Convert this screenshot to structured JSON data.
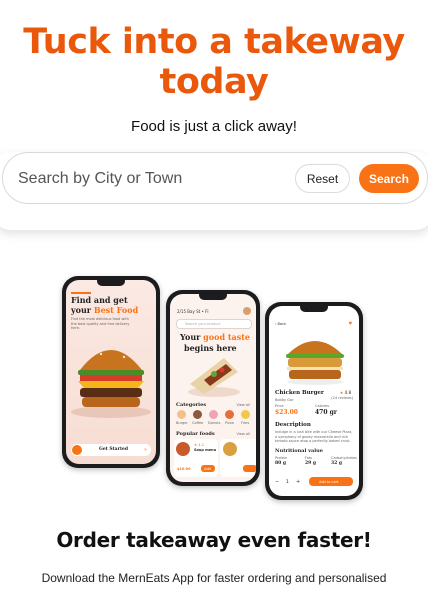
{
  "hero": {
    "title_line1": "Tuck into a takeway",
    "title_line2": "today",
    "subtitle": "Food is just a click away!"
  },
  "search": {
    "placeholder": "Search by City or Town",
    "value": "",
    "reset_label": "Reset",
    "search_label": "Search"
  },
  "promo": {
    "title": "Order takeaway even faster!",
    "subtitle": "Download the MernEats App for faster ordering and personalised"
  },
  "phone_mockups": {
    "left": {
      "heading_line1": "Find and get",
      "heading_line2_plain": "your ",
      "heading_line2_accent": "Best Food",
      "body": "Find the most delicious food with the best quality and free delivery here.",
      "cta": "Get Started"
    },
    "middle": {
      "location": "2/15 Bay St • Fl",
      "search_placeholder": "Search your product",
      "headline_plain": "Your ",
      "headline_accent": "good taste",
      "headline_line2": "begins here",
      "categories_title": "Categories",
      "categories_link": "View all",
      "categories": [
        "Burger",
        "Coffee",
        "Donuts",
        "Pizza",
        "Fries"
      ],
      "popular_title": "Popular foods",
      "popular_link": "View all",
      "popular_item_name": "Soup menu",
      "popular_item_rating": "★ 4.2",
      "popular_item_price": "$10.00",
      "add_label": "Add"
    },
    "right": {
      "back_label": "Back",
      "product_name": "Chicken Burger",
      "rating": "4.8",
      "rating_sub": "(24 reviews)",
      "store": "Bobby Gar",
      "price_label": "Price",
      "price": "$23.00",
      "calories_label": "Calories",
      "calories": "470 gr",
      "description_title": "Description",
      "description": "Indulge in a lush bite with our Cheese Pizza, a symphony of gooey mozzarella and rich tomato sauce atop a perfectly baked crust. Read more...",
      "nutrition_title": "Nutritional value",
      "nutrition": [
        {
          "label": "Protein",
          "value": "80 g"
        },
        {
          "label": "Fats",
          "value": "29 g"
        },
        {
          "label": "Carbohydrates",
          "value": "32 g"
        }
      ],
      "quantity": "1",
      "cart_label": "Add to cart"
    }
  },
  "colors": {
    "accent": "#ea580c",
    "button": "#f97316"
  }
}
